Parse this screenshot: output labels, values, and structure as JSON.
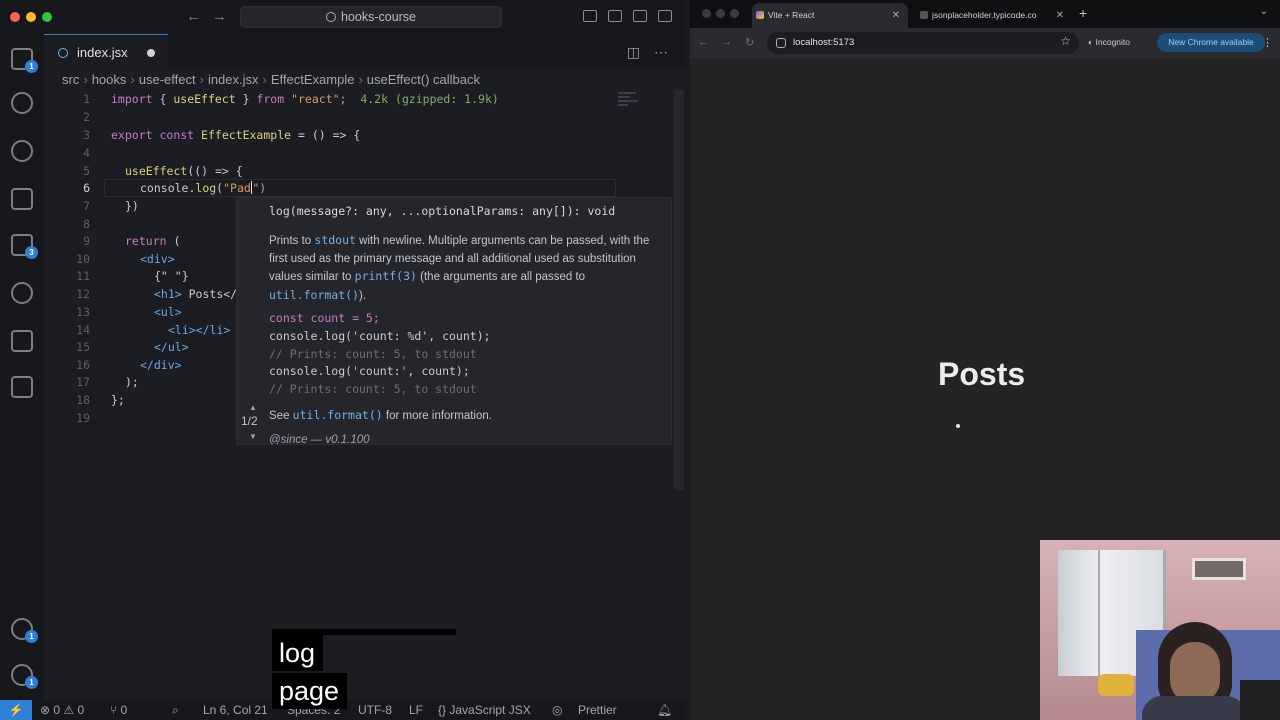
{
  "vscode": {
    "search": "hooks-course",
    "tab": {
      "filename": "index.jsx"
    },
    "breadcrumb": [
      "src",
      "hooks",
      "use-effect",
      "index.jsx",
      "EffectExample",
      "useEffect() callback"
    ],
    "line_numbers": [
      "1",
      "2",
      "3",
      "4",
      "5",
      "6",
      "7",
      "8",
      "9",
      "10",
      "11",
      "12",
      "13",
      "14",
      "15",
      "16",
      "17",
      "18",
      "19"
    ],
    "current_line": "6",
    "code": {
      "l1_kw": "import",
      "l1_b": "{ ",
      "l1_fn": "useEffect",
      "l1_c": " } ",
      "l1_from": "from",
      "l1_str": "\"react\";",
      "l1_hint": "4.2k (gzipped: 1.9k)",
      "l3_kw1": "export",
      "l3_kw2": "const",
      "l3_fn": "EffectExample",
      "l3_rest": " = () => {",
      "l5_fn": "useEffect",
      "l5_rest": "(() => {",
      "l6_a": "console.",
      "l6_fn": "log",
      "l6_b": "(",
      "l6_str": "\"Pad",
      "l6_c": "\")",
      "l7": "})",
      "l9_kw": "return",
      "l9_rest": " (",
      "l10": "<div>",
      "l11": "{\" \"}",
      "l12_tag": "<h1>",
      "l12_text": " Posts</",
      "l13": "<ul>",
      "l14": "<li></li>",
      "l15": "</ul>",
      "l16": "</div>",
      "l17": ");",
      "l18": "};"
    },
    "hover": {
      "signature": "log(message?: any, ...optionalParams: any[]): void",
      "desc_1": "Prints to ",
      "desc_code1": "stdout",
      "desc_2": " with newline. Multiple arguments can be passed, with the first used as the primary message and all additional used as substitution values similar to ",
      "desc_code2": "printf(3)",
      "desc_3": " (the arguments are all passed to ",
      "desc_code3": "util.format()",
      "desc_4": ").",
      "ex1": "const count = 5;",
      "ex2": "console.log('count: %d', count);",
      "ex3": "// Prints: count: 5, to stdout",
      "ex4": "console.log('count:', count);",
      "ex5": "// Prints: count: 5, to stdout",
      "see_1": "See ",
      "see_code": "util.format()",
      "see_2": " for more information.",
      "pager": "1/2",
      "since": "@since — v0.1.100"
    },
    "statusbar": {
      "errors": "⊗ 0 ⚠ 0",
      "ports": "⑂ 0",
      "position": "Ln 6, Col 21",
      "spaces": "Spaces: 2",
      "encoding": "UTF-8",
      "eol": "LF",
      "language": "{} JavaScript JSX",
      "formatter": "Prettier"
    },
    "activity_badges": [
      "1",
      "3",
      "1",
      "1"
    ]
  },
  "caption": {
    "line1": "log",
    "line2": "page"
  },
  "chrome": {
    "tabs": [
      {
        "label": "Vite + React"
      },
      {
        "label": "jsonplaceholder.typicode.co"
      }
    ],
    "url": "localhost:5173",
    "incognito": "Incognito",
    "update": "New Chrome available",
    "page": {
      "heading": "Posts"
    }
  },
  "colors": {
    "accent": "#2f7fd6",
    "editor_bg": "#1c1d22",
    "page_bg": "#242424"
  }
}
